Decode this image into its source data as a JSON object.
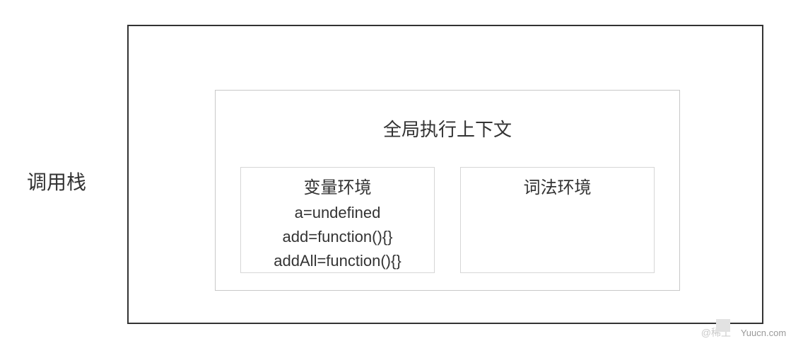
{
  "diagram": {
    "outer_label": "调用栈",
    "context": {
      "title": "全局执行上下文",
      "variable_env": {
        "title": "变量环境",
        "lines": [
          "a=undefined",
          "add=function(){}",
          "addAll=function(){}"
        ]
      },
      "lexical_env": {
        "title": "词法环境"
      }
    }
  },
  "watermark": {
    "prefix": "@稀土",
    "site": "Yuucn.com"
  }
}
